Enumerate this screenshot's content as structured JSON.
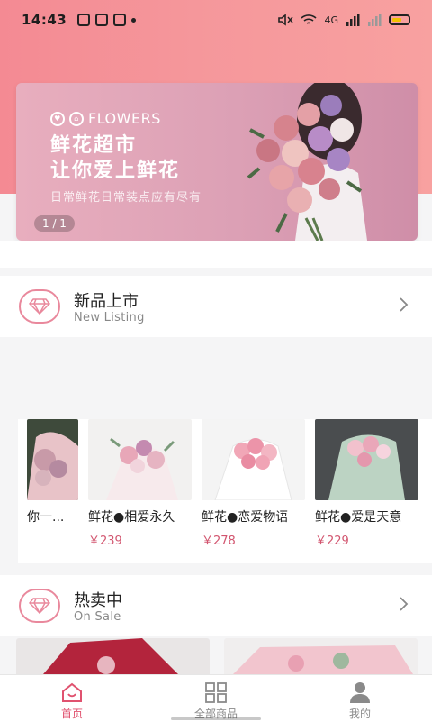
{
  "status": {
    "time": "14:43",
    "network": "4G"
  },
  "banner": {
    "brand": "FLOWERS",
    "headline_line1": "鲜花超市",
    "headline_line2": "让你爱上鲜花",
    "subtitle": "日常鲜花日常装点应有尽有",
    "pager": "1 / 1"
  },
  "sections": {
    "new": {
      "title": "新品上市",
      "subtitle": "New Listing"
    },
    "hot": {
      "title": "热卖中",
      "subtitle": "On Sale"
    }
  },
  "products": [
    {
      "name": "你一...",
      "price": ""
    },
    {
      "name": "鲜花●相爱永久",
      "price": "￥239"
    },
    {
      "name": "鲜花●恋爱物语",
      "price": "￥278"
    },
    {
      "name": "鲜花●爱是天意",
      "price": "￥229"
    }
  ],
  "tabs": [
    {
      "label": "首页",
      "icon": "home-icon"
    },
    {
      "label": "全部商品",
      "icon": "grid-icon"
    },
    {
      "label": "我的",
      "icon": "user-icon"
    }
  ],
  "colors": {
    "accent": "#e0526f",
    "price": "#d2556f",
    "header_gradient": "#f48a93"
  }
}
